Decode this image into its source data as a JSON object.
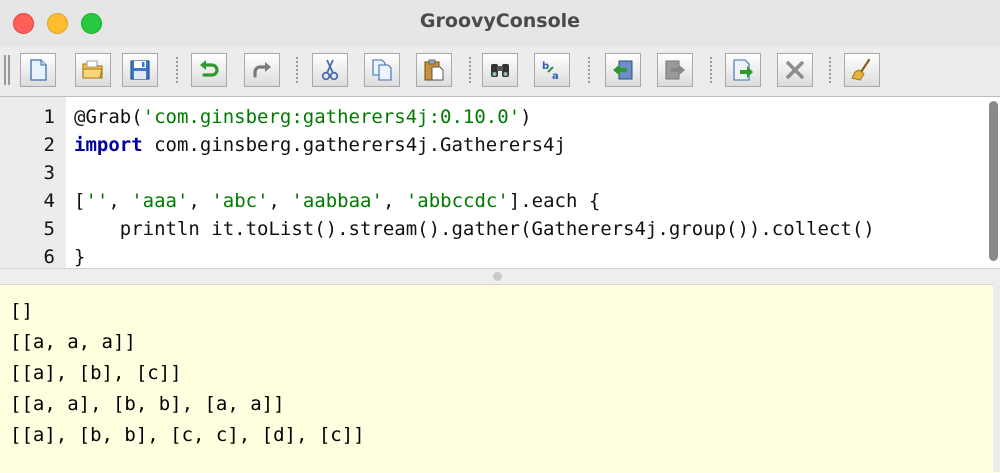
{
  "window": {
    "title": "GroovyConsole"
  },
  "toolbar": {
    "buttons": [
      {
        "name": "new-file-button",
        "icon": "new-document-icon"
      },
      {
        "name": "open-file-button",
        "icon": "open-folder-icon"
      },
      {
        "name": "save-button",
        "icon": "save-disk-icon"
      },
      {
        "name": "undo-button",
        "icon": "undo-arrow-icon"
      },
      {
        "name": "redo-button",
        "icon": "redo-arrow-icon"
      },
      {
        "name": "cut-button",
        "icon": "scissors-icon"
      },
      {
        "name": "copy-button",
        "icon": "copy-pages-icon"
      },
      {
        "name": "paste-button",
        "icon": "clipboard-icon"
      },
      {
        "name": "find-button",
        "icon": "binoculars-icon"
      },
      {
        "name": "replace-button",
        "icon": "find-replace-icon"
      },
      {
        "name": "history-previous-button",
        "icon": "history-back-icon"
      },
      {
        "name": "history-next-button",
        "icon": "history-forward-icon"
      },
      {
        "name": "run-script-button",
        "icon": "run-script-icon"
      },
      {
        "name": "interrupt-button",
        "icon": "close-x-icon"
      },
      {
        "name": "clear-output-button",
        "icon": "broom-icon"
      }
    ]
  },
  "editor": {
    "lines": [
      {
        "num": "1",
        "tokens": [
          {
            "t": "@Grab(",
            "c": "plain"
          },
          {
            "t": "'com.ginsberg:gatherers4j:0.10.0'",
            "c": "str"
          },
          {
            "t": ")",
            "c": "plain"
          }
        ]
      },
      {
        "num": "2",
        "tokens": [
          {
            "t": "import",
            "c": "kw"
          },
          {
            "t": " com.ginsberg.gatherers4j.Gatherers4j",
            "c": "plain"
          }
        ]
      },
      {
        "num": "3",
        "tokens": []
      },
      {
        "num": "4",
        "tokens": [
          {
            "t": "[",
            "c": "plain"
          },
          {
            "t": "''",
            "c": "str"
          },
          {
            "t": ", ",
            "c": "plain"
          },
          {
            "t": "'aaa'",
            "c": "str"
          },
          {
            "t": ", ",
            "c": "plain"
          },
          {
            "t": "'abc'",
            "c": "str"
          },
          {
            "t": ", ",
            "c": "plain"
          },
          {
            "t": "'aabbaa'",
            "c": "str"
          },
          {
            "t": ", ",
            "c": "plain"
          },
          {
            "t": "'abbccdc'",
            "c": "str"
          },
          {
            "t": "].each {",
            "c": "plain"
          }
        ]
      },
      {
        "num": "5",
        "tokens": [
          {
            "t": "    println it.toList().stream().gather(Gatherers4j.group()).collect()",
            "c": "plain"
          }
        ]
      },
      {
        "num": "6",
        "tokens": [
          {
            "t": "}",
            "c": "plain"
          }
        ]
      }
    ]
  },
  "output": {
    "lines": [
      "[]",
      "[[a, a, a]]",
      "[[a], [b], [c]]",
      "[[a, a], [b, b], [a, a]]",
      "[[a], [b, b], [c, c], [d], [c]]"
    ]
  }
}
